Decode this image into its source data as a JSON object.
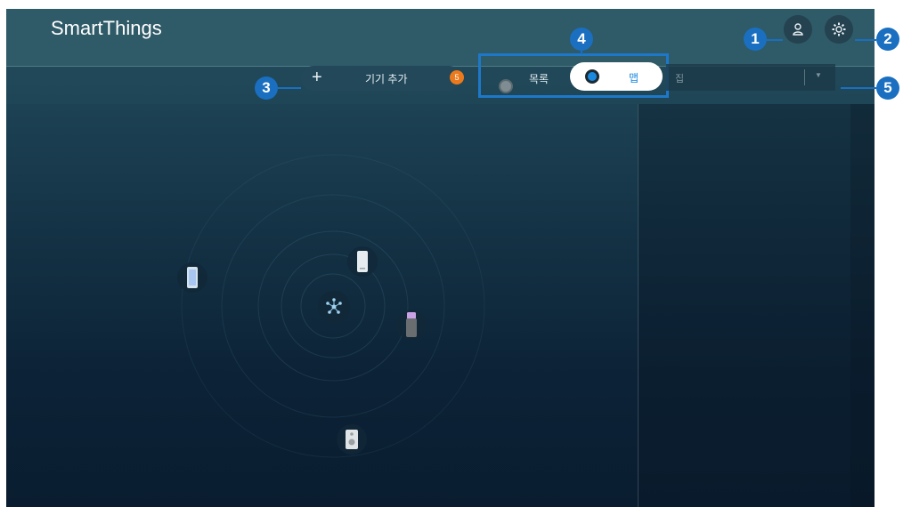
{
  "app": {
    "title": "SmartThings"
  },
  "toolbar": {
    "add_plus": "+",
    "add_label": "기기 추가",
    "notification_count": "5"
  },
  "view_toggle": {
    "list_label": "목록",
    "map_label": "맵",
    "selected": "맵"
  },
  "location": {
    "label": "집",
    "dropdown_icon": "▼"
  },
  "icons": {
    "account": "account-icon",
    "settings": "gear-icon",
    "hub": "hub-icon"
  },
  "callouts": [
    "1",
    "2",
    "3",
    "4",
    "5"
  ],
  "colors": {
    "accent": "#1a6fc0",
    "badge": "#ec7a1c",
    "header": "#2f5a68"
  }
}
